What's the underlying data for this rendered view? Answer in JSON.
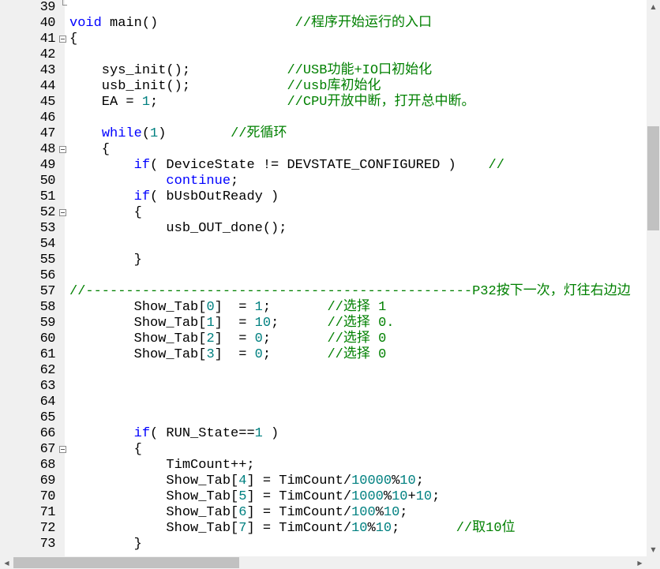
{
  "editor": {
    "lines": [
      {
        "n": "39",
        "fold": "end",
        "tokens": []
      },
      {
        "n": "40",
        "fold": "",
        "tokens": [
          {
            "c": "kw",
            "t": "void"
          },
          {
            "c": "pl",
            "t": " main()                 "
          },
          {
            "c": "cm",
            "t": "//程序开始运行的入口"
          }
        ]
      },
      {
        "n": "41",
        "fold": "box",
        "tokens": [
          {
            "c": "pl",
            "t": "{"
          }
        ]
      },
      {
        "n": "42",
        "fold": "",
        "tokens": []
      },
      {
        "n": "43",
        "fold": "",
        "tokens": [
          {
            "c": "pl",
            "t": "    sys_init();            "
          },
          {
            "c": "cm",
            "t": "//USB功能+IO口初始化"
          }
        ]
      },
      {
        "n": "44",
        "fold": "",
        "tokens": [
          {
            "c": "pl",
            "t": "    usb_init();            "
          },
          {
            "c": "cm",
            "t": "//usb库初始化"
          }
        ]
      },
      {
        "n": "45",
        "fold": "",
        "tokens": [
          {
            "c": "pl",
            "t": "    EA = "
          },
          {
            "c": "num",
            "t": "1"
          },
          {
            "c": "pl",
            "t": ";                "
          },
          {
            "c": "cm",
            "t": "//CPU开放中断，打开总中断。"
          }
        ]
      },
      {
        "n": "46",
        "fold": "",
        "tokens": []
      },
      {
        "n": "47",
        "fold": "",
        "tokens": [
          {
            "c": "pl",
            "t": "    "
          },
          {
            "c": "kw",
            "t": "while"
          },
          {
            "c": "pl",
            "t": "("
          },
          {
            "c": "num",
            "t": "1"
          },
          {
            "c": "pl",
            "t": ")        "
          },
          {
            "c": "cm",
            "t": "//死循环"
          }
        ]
      },
      {
        "n": "48",
        "fold": "box",
        "tokens": [
          {
            "c": "pl",
            "t": "    {"
          }
        ]
      },
      {
        "n": "49",
        "fold": "",
        "tokens": [
          {
            "c": "pl",
            "t": "        "
          },
          {
            "c": "kw",
            "t": "if"
          },
          {
            "c": "pl",
            "t": "( DeviceState != DEVSTATE_CONFIGURED )    "
          },
          {
            "c": "cm",
            "t": "//"
          }
        ]
      },
      {
        "n": "50",
        "fold": "",
        "tokens": [
          {
            "c": "pl",
            "t": "            "
          },
          {
            "c": "kw",
            "t": "continue"
          },
          {
            "c": "pl",
            "t": ";"
          }
        ]
      },
      {
        "n": "51",
        "fold": "",
        "tokens": [
          {
            "c": "pl",
            "t": "        "
          },
          {
            "c": "kw",
            "t": "if"
          },
          {
            "c": "pl",
            "t": "( bUsbOutReady )"
          }
        ]
      },
      {
        "n": "52",
        "fold": "box",
        "tokens": [
          {
            "c": "pl",
            "t": "        {"
          }
        ]
      },
      {
        "n": "53",
        "fold": "",
        "tokens": [
          {
            "c": "pl",
            "t": "            usb_OUT_done();"
          }
        ]
      },
      {
        "n": "54",
        "fold": "",
        "tokens": []
      },
      {
        "n": "55",
        "fold": "",
        "tokens": [
          {
            "c": "pl",
            "t": "        }"
          }
        ]
      },
      {
        "n": "56",
        "fold": "",
        "tokens": []
      },
      {
        "n": "57",
        "fold": "",
        "tokens": [
          {
            "c": "cm",
            "t": "//------------------------------------------------P32按下一次，灯往右边边"
          }
        ]
      },
      {
        "n": "58",
        "fold": "",
        "tokens": [
          {
            "c": "pl",
            "t": "        Show_Tab["
          },
          {
            "c": "num",
            "t": "0"
          },
          {
            "c": "pl",
            "t": "]  = "
          },
          {
            "c": "num",
            "t": "1"
          },
          {
            "c": "pl",
            "t": ";       "
          },
          {
            "c": "cm",
            "t": "//选择 1"
          }
        ]
      },
      {
        "n": "59",
        "fold": "",
        "tokens": [
          {
            "c": "pl",
            "t": "        Show_Tab["
          },
          {
            "c": "num",
            "t": "1"
          },
          {
            "c": "pl",
            "t": "]  = "
          },
          {
            "c": "num",
            "t": "10"
          },
          {
            "c": "pl",
            "t": ";      "
          },
          {
            "c": "cm",
            "t": "//选择 0."
          }
        ]
      },
      {
        "n": "60",
        "fold": "",
        "tokens": [
          {
            "c": "pl",
            "t": "        Show_Tab["
          },
          {
            "c": "num",
            "t": "2"
          },
          {
            "c": "pl",
            "t": "]  = "
          },
          {
            "c": "num",
            "t": "0"
          },
          {
            "c": "pl",
            "t": ";       "
          },
          {
            "c": "cm",
            "t": "//选择 0"
          }
        ]
      },
      {
        "n": "61",
        "fold": "",
        "tokens": [
          {
            "c": "pl",
            "t": "        Show_Tab["
          },
          {
            "c": "num",
            "t": "3"
          },
          {
            "c": "pl",
            "t": "]  = "
          },
          {
            "c": "num",
            "t": "0"
          },
          {
            "c": "pl",
            "t": ";       "
          },
          {
            "c": "cm",
            "t": "//选择 0"
          }
        ]
      },
      {
        "n": "62",
        "fold": "",
        "tokens": []
      },
      {
        "n": "63",
        "fold": "",
        "tokens": []
      },
      {
        "n": "64",
        "fold": "",
        "tokens": []
      },
      {
        "n": "65",
        "fold": "",
        "tokens": []
      },
      {
        "n": "66",
        "fold": "",
        "tokens": [
          {
            "c": "pl",
            "t": "        "
          },
          {
            "c": "kw",
            "t": "if"
          },
          {
            "c": "pl",
            "t": "( RUN_State=="
          },
          {
            "c": "num",
            "t": "1"
          },
          {
            "c": "pl",
            "t": " )"
          }
        ]
      },
      {
        "n": "67",
        "fold": "box",
        "tokens": [
          {
            "c": "pl",
            "t": "        {"
          }
        ]
      },
      {
        "n": "68",
        "fold": "",
        "tokens": [
          {
            "c": "pl",
            "t": "            TimCount++;"
          }
        ]
      },
      {
        "n": "69",
        "fold": "",
        "tokens": [
          {
            "c": "pl",
            "t": "            Show_Tab["
          },
          {
            "c": "num",
            "t": "4"
          },
          {
            "c": "pl",
            "t": "] = TimCount/"
          },
          {
            "c": "num",
            "t": "10000"
          },
          {
            "c": "pl",
            "t": "%"
          },
          {
            "c": "num",
            "t": "10"
          },
          {
            "c": "pl",
            "t": ";"
          }
        ]
      },
      {
        "n": "70",
        "fold": "",
        "tokens": [
          {
            "c": "pl",
            "t": "            Show_Tab["
          },
          {
            "c": "num",
            "t": "5"
          },
          {
            "c": "pl",
            "t": "] = TimCount/"
          },
          {
            "c": "num",
            "t": "1000"
          },
          {
            "c": "pl",
            "t": "%"
          },
          {
            "c": "num",
            "t": "10"
          },
          {
            "c": "pl",
            "t": "+"
          },
          {
            "c": "num",
            "t": "10"
          },
          {
            "c": "pl",
            "t": ";"
          }
        ]
      },
      {
        "n": "71",
        "fold": "",
        "tokens": [
          {
            "c": "pl",
            "t": "            Show_Tab["
          },
          {
            "c": "num",
            "t": "6"
          },
          {
            "c": "pl",
            "t": "] = TimCount/"
          },
          {
            "c": "num",
            "t": "100"
          },
          {
            "c": "pl",
            "t": "%"
          },
          {
            "c": "num",
            "t": "10"
          },
          {
            "c": "pl",
            "t": ";"
          }
        ]
      },
      {
        "n": "72",
        "fold": "",
        "tokens": [
          {
            "c": "pl",
            "t": "            Show_Tab["
          },
          {
            "c": "num",
            "t": "7"
          },
          {
            "c": "pl",
            "t": "] = TimCount/"
          },
          {
            "c": "num",
            "t": "10"
          },
          {
            "c": "pl",
            "t": "%"
          },
          {
            "c": "num",
            "t": "10"
          },
          {
            "c": "pl",
            "t": ";       "
          },
          {
            "c": "cm",
            "t": "//取10位"
          }
        ]
      },
      {
        "n": "73",
        "fold": "",
        "tokens": [
          {
            "c": "pl",
            "t": "        }"
          }
        ]
      }
    ]
  },
  "scrollbars": {
    "up_icon": "arrow-up-icon",
    "down_icon": "arrow-down-icon",
    "left_icon": "arrow-left-icon",
    "right_icon": "arrow-right-icon"
  },
  "colors": {
    "keyword": "#0000ff",
    "number": "#008080",
    "comment": "#008000",
    "gutter": "#f0f0f0"
  }
}
